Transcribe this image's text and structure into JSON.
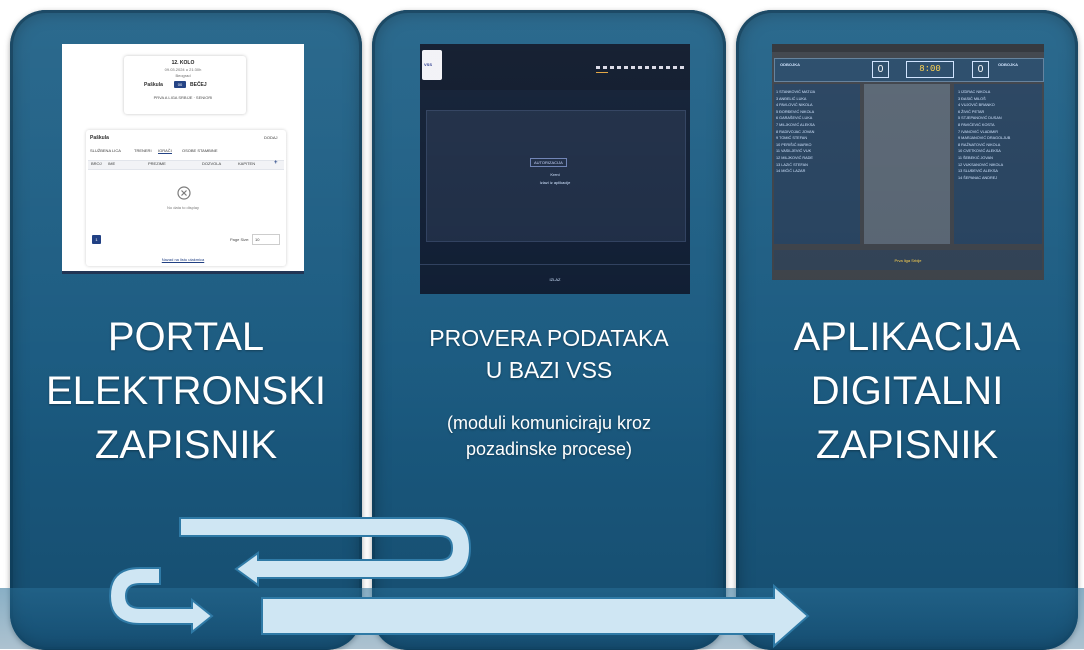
{
  "panels": [
    {
      "title_lines": [
        "PORTAL",
        "ELEKTRONSKI",
        "ZAPISNIK"
      ]
    },
    {
      "title_lines": [
        "PROVERA PODATAKA",
        "U BAZI VSS"
      ],
      "subtitle_lines": [
        "(moduli komuniciraju kroz",
        "pozadinske procese)"
      ]
    },
    {
      "title_lines": [
        "APLIKACIJA",
        "DIGITALNI",
        "ZAPISNIK"
      ]
    }
  ],
  "screenshot1": {
    "round": "12. KOLO",
    "date": "09.03.2024 u 21:30h",
    "city": "Beograd",
    "team_home": "Paškula",
    "score_badge": "00",
    "team_away": "BEČEJ",
    "league": "PRVA A LIGA SRBIJE · SENIORI",
    "section_title": "Paškula",
    "section_action": "DODAJ",
    "tabs": [
      "SLUŽBENA LICA",
      "TRENERI",
      "IGRAČI",
      "OSOBE STAMBINE"
    ],
    "columns": [
      "BROJ",
      "IME",
      "PREZIME",
      "DOZVOLA",
      "KAPITEN",
      "+"
    ],
    "empty_text": "No data to display",
    "page_number": "1",
    "page_size_label": "Page Size:",
    "page_size_value": "10",
    "footer_link": "Nazad na listu utakmica"
  },
  "screenshot2": {
    "logo_text": "VSS",
    "box_button": "AUTORIZACIJA",
    "box_line1": "Kreni",
    "box_line2": "Izlazi iz aplikacije",
    "footer": "IZLAZ"
  },
  "screenshot3": {
    "team_left": "ODBOJKA",
    "team_right": "ODBOJKA",
    "score_left": "0",
    "score_right": "0",
    "clock": "8:00",
    "players_left": [
      "1 STANKOVIĆ MATIJA",
      "3 ANĐELIĆ LUKA",
      "4 PAVLOVIĆ NIKOLA",
      "5 ĐORĐEVIĆ NIKOLA",
      "6 GARAŠEVIĆ LUKA",
      "7 MILJKOVIĆ ALEKSA",
      "8 RADIVOJAC JOVAN",
      "9 TOMIĆ STEFAN",
      "10 PERIŠIĆ MARKO",
      "11 VASILJEVIĆ VUK",
      "12 MILJKOVIĆ RADE",
      "13 LAZIĆ STEFAN",
      "14 MIĆIĆ LAZAR"
    ],
    "players_right": [
      "1 IZDRAC NIKOLA",
      "3 ĐASIĆ MILOŠ",
      "4 VUJOVIĆ BRANKO",
      "6 ŽIVIĆ PETAR",
      "5 STJEPANOVIĆ DUSAN",
      "8 PAVIĆEVIĆ KOSTA",
      "7 IVANOVIĆ VLADIMIR",
      "9 MARJANOVIĆ DRAGOLJUB",
      "8 RAŽNATOVIĆ NIKOLA",
      "10 CVETKOVIĆ ALEKSA",
      "11 ŠEBEKIĆ JOVAN",
      "12 VUKSANOVIĆ NIKOLA",
      "13 SLUĐEVIĆ ALEKSA",
      "14 ŠEPANAC ANDREJ"
    ],
    "footer": "Prva liga Srbije"
  },
  "colors": {
    "panel": "#1f6187",
    "panel_border": "#0f3f5c",
    "arrow_fill": "#cfe6f3",
    "arrow_stroke": "#2f7aa6",
    "title": "#ffffff"
  }
}
